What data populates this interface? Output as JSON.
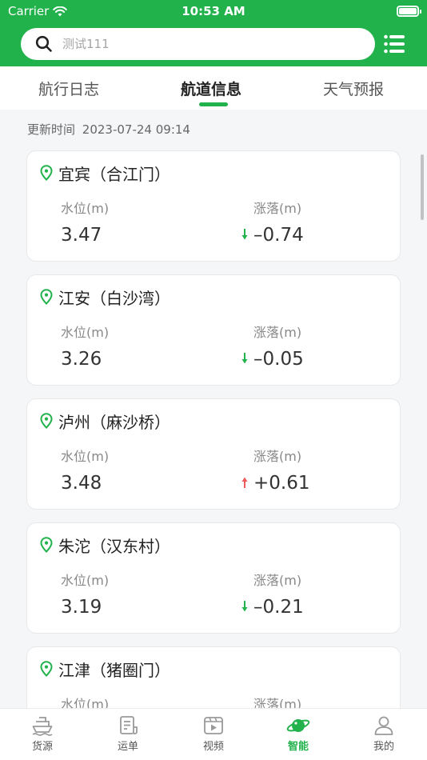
{
  "status_bar": {
    "carrier": "Carrier",
    "time": "10:53 AM"
  },
  "search": {
    "placeholder": "测试111"
  },
  "tabs": [
    {
      "label": "航行日志",
      "active": false
    },
    {
      "label": "航道信息",
      "active": true
    },
    {
      "label": "天气预报",
      "active": false
    }
  ],
  "updated": {
    "label": "更新时间",
    "value": "2023-07-24 09:14"
  },
  "stations": [
    {
      "name": "宜宾（合江门）",
      "level_label": "水位(m)",
      "level": "3.47",
      "change_label": "涨落(m)",
      "change": "–0.74",
      "trend": "down"
    },
    {
      "name": "江安（白沙湾）",
      "level_label": "水位(m)",
      "level": "3.26",
      "change_label": "涨落(m)",
      "change": "–0.05",
      "trend": "down"
    },
    {
      "name": "泸州（麻沙桥）",
      "level_label": "水位(m)",
      "level": "3.48",
      "change_label": "涨落(m)",
      "change": "+0.61",
      "trend": "up"
    },
    {
      "name": "朱沱（汉东村）",
      "level_label": "水位(m)",
      "level": "3.19",
      "change_label": "涨落(m)",
      "change": "–0.21",
      "trend": "down"
    },
    {
      "name": "江津（猪圈门）",
      "level_label": "水位(m)",
      "level": "",
      "change_label": "涨落(m)",
      "change": "",
      "trend": ""
    }
  ],
  "bottom_nav": [
    {
      "label": "货源",
      "icon": "ship-icon",
      "active": false
    },
    {
      "label": "运单",
      "icon": "document-icon",
      "active": false
    },
    {
      "label": "视频",
      "icon": "video-icon",
      "active": false
    },
    {
      "label": "智能",
      "icon": "planet-icon",
      "active": true
    },
    {
      "label": "我的",
      "icon": "user-icon",
      "active": false
    }
  ],
  "colors": {
    "brand": "#22b24c",
    "trend_down": "#22b24c",
    "trend_up": "#f05a5a"
  }
}
